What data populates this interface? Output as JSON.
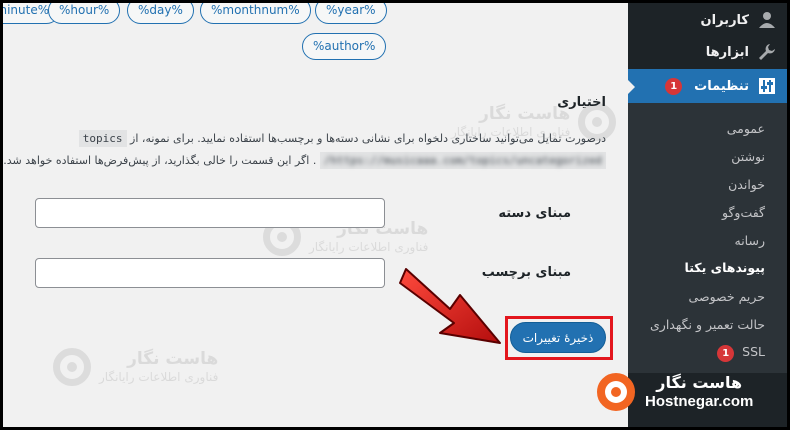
{
  "tags": [
    "%minute%",
    "%hour%",
    "%day%",
    "%monthnum%",
    "%year%",
    "%author%"
  ],
  "optional": {
    "title": "اختیاری",
    "line1_prefix": "درصورت تمایل می‌توانید ساختاری دلخواه برای نشانی دسته‌ها و برچسب‌ها استفاده نمایید. برای نمونه، از",
    "line1_code": "topics",
    "line2_code": "https://musicaaa.com/topics/uncategorized/",
    "line2_suffix": ". اگر این قسمت را خالی بگذارید، از پیش‌فرض‌ها استفاده خواهد شد."
  },
  "fields": {
    "category_label": "مبنای دسته",
    "category_value": "",
    "tag_label": "مبنای برچسب",
    "tag_value": ""
  },
  "save_button": "ذخیرهٔ تغییرات",
  "sidebar": {
    "users": "کاربران",
    "tools": "ابزارها",
    "settings": "تنظیمات",
    "settings_badge": "1",
    "items": {
      "general": "عمومی",
      "writing": "نوشتن",
      "reading": "خواندن",
      "discussion": "گفت‌وگو",
      "media": "رسانه",
      "permalinks": "پیوندهای یکتا",
      "privacy": "حریم خصوصی",
      "maintenance": "حالت تعمیر و نگهداری",
      "ssl": "SSL",
      "ssl_badge": "1"
    }
  },
  "watermark": {
    "line1": "هاست نگار",
    "line2": "فناوری اطلاعات رایانگار"
  },
  "brand": {
    "fa": "هاست نگار",
    "en": "Hostnegar.com"
  },
  "colors": {
    "accent": "#2271b1",
    "sidebar": "#1d2327",
    "highlight": "#e3161d",
    "arrow": "#e3161d",
    "brand": "#f26522"
  }
}
